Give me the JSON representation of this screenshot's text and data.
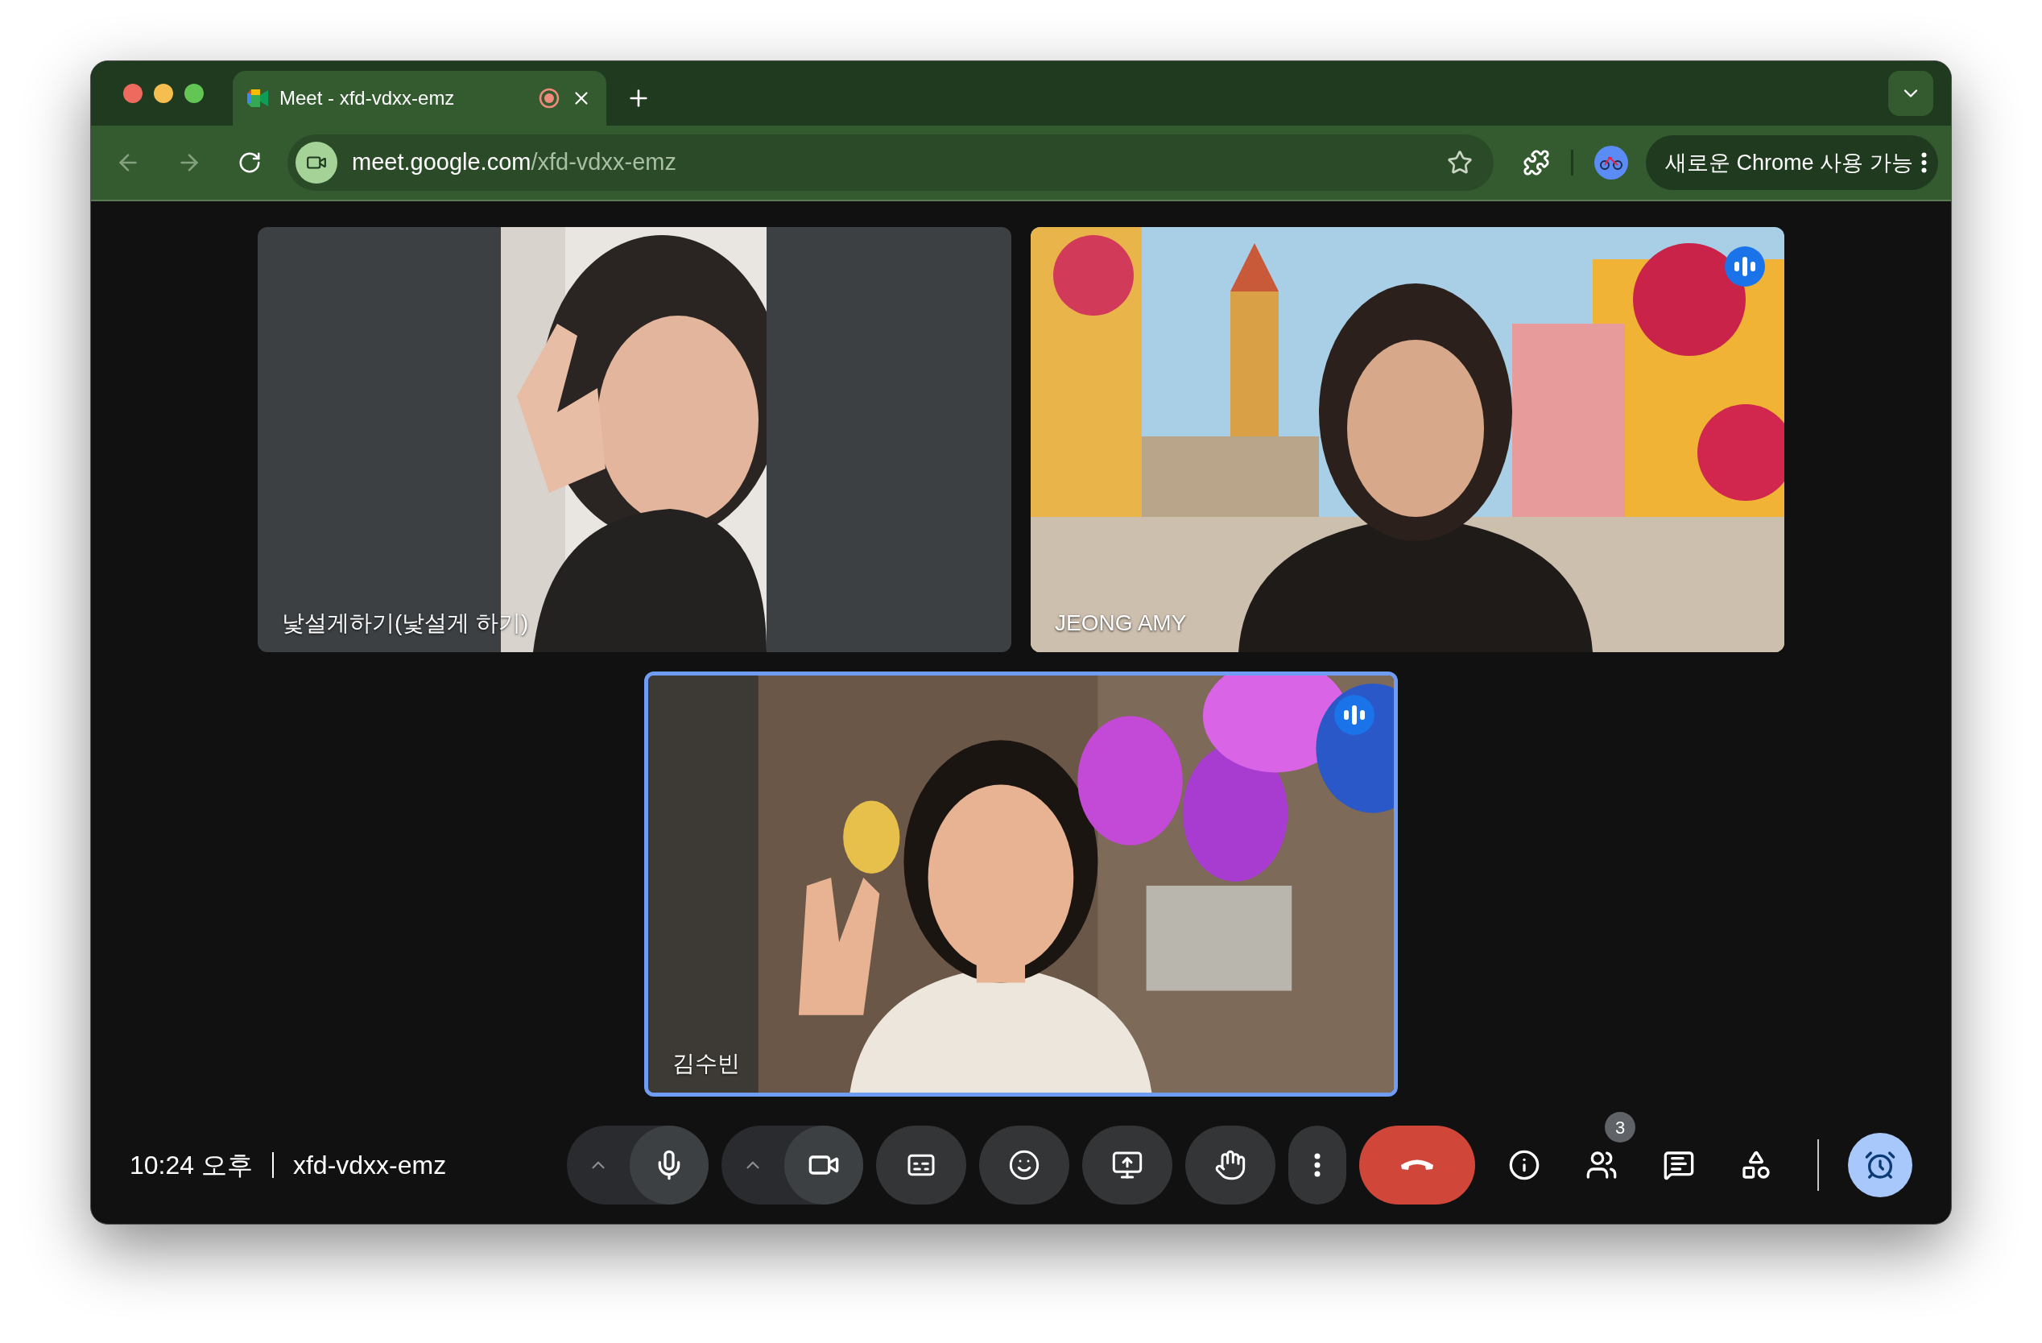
{
  "browser": {
    "tab": {
      "title": "Meet - xfd-vdxx-emz",
      "recording": true
    },
    "url": {
      "host": "meet.google.com",
      "path": "/xfd-vdxx-emz"
    },
    "update_button": "새로운 Chrome 사용 가능"
  },
  "participants": [
    {
      "name": "낯설게하기(낯설게 하기)",
      "speaking": false,
      "highlighted": false,
      "kind": "portrait"
    },
    {
      "name": "JEONG AMY",
      "speaking": true,
      "highlighted": false,
      "kind": "street"
    },
    {
      "name": "김수빈",
      "speaking": true,
      "highlighted": true,
      "kind": "balloons"
    }
  ],
  "meeting": {
    "time": "10:24 오후",
    "code": "xfd-vdxx-emz"
  },
  "controls": [
    {
      "kind": "mic",
      "on": true
    },
    {
      "kind": "camera",
      "on": true
    },
    {
      "kind": "captions"
    },
    {
      "kind": "reactions"
    },
    {
      "kind": "present"
    },
    {
      "kind": "raise-hand"
    },
    {
      "kind": "more"
    },
    {
      "kind": "leave"
    }
  ],
  "side_controls": [
    {
      "kind": "info",
      "active": false
    },
    {
      "kind": "people",
      "badge": "3",
      "active": false
    },
    {
      "kind": "chat",
      "active": false
    },
    {
      "kind": "activities",
      "active": false
    },
    {
      "kind": "timer",
      "active": true
    }
  ]
}
